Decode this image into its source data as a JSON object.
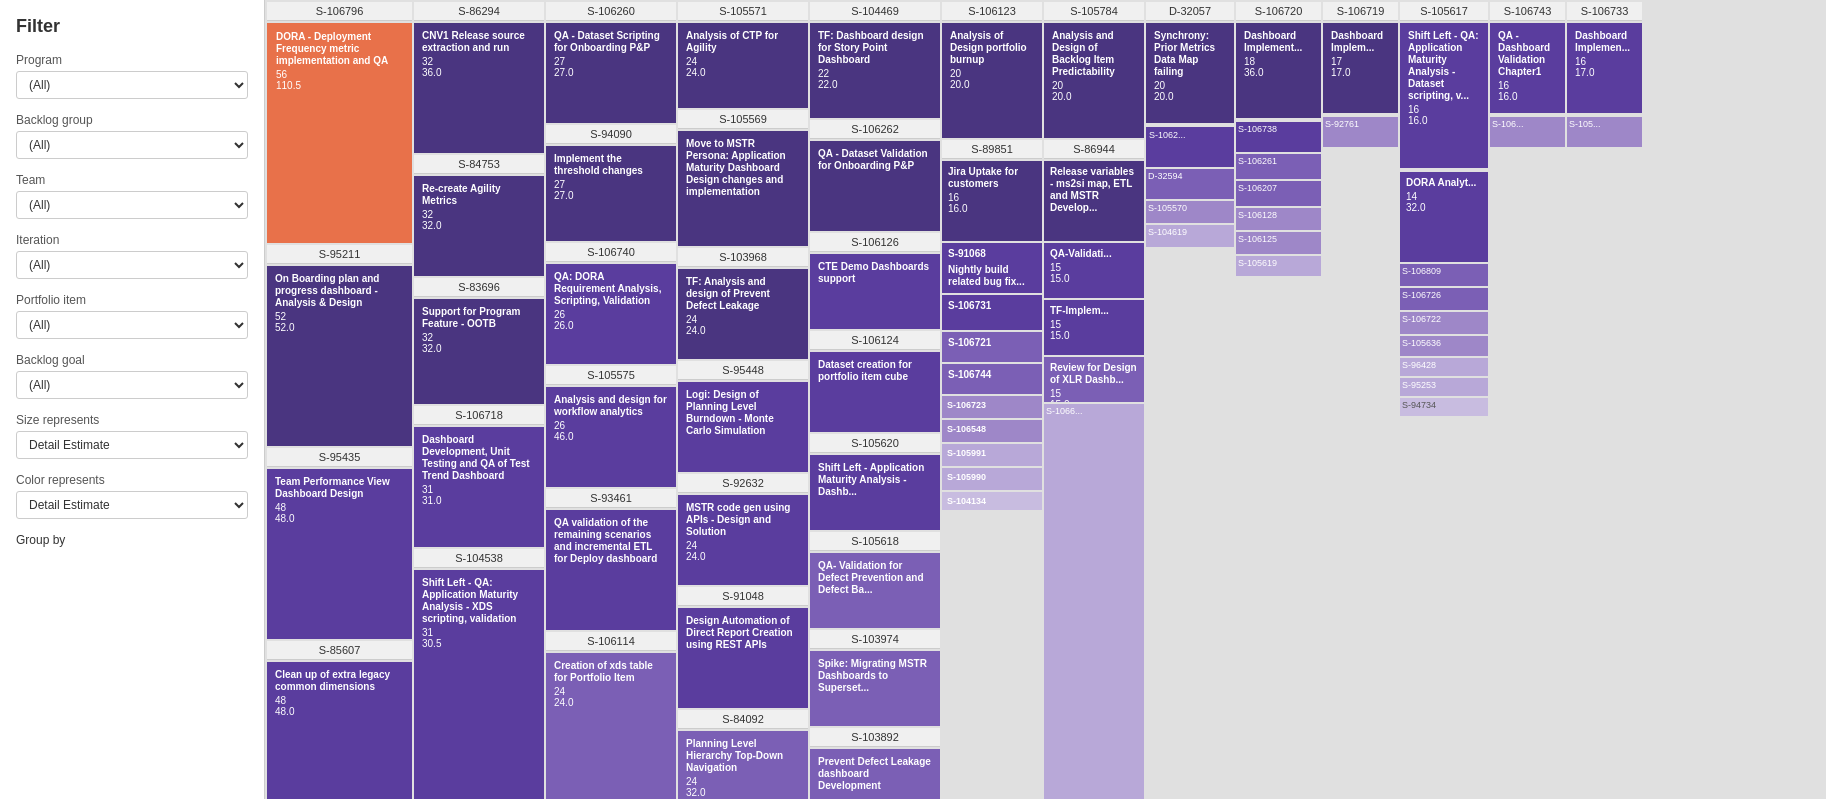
{
  "sidebar": {
    "title": "Filter",
    "filters": [
      {
        "id": "program",
        "label": "Program",
        "value": "(All)"
      },
      {
        "id": "backlog_group",
        "label": "Backlog group",
        "value": "(All)"
      },
      {
        "id": "team",
        "label": "Team",
        "value": "(All)"
      },
      {
        "id": "iteration",
        "label": "Iteration",
        "value": "(All)"
      },
      {
        "id": "portfolio_item",
        "label": "Portfolio item",
        "value": "(All)"
      },
      {
        "id": "backlog_goal",
        "label": "Backlog goal",
        "value": "(All)"
      }
    ],
    "size_represents_label": "Size represents",
    "size_represents_value": "Detail Estimate",
    "color_represents_label": "Color represents",
    "color_represents_value": "Detail Estimate",
    "group_by_label": "Group by"
  },
  "columns": [
    {
      "id": "S-106796",
      "header": "S-106796",
      "width": 145
    },
    {
      "id": "S-86294",
      "header": "S-86294",
      "width": 130
    },
    {
      "id": "S-106260",
      "header": "S-106260",
      "width": 130
    },
    {
      "id": "S-105571",
      "header": "S-105571",
      "width": 130
    },
    {
      "id": "S-104469",
      "header": "S-104469",
      "width": 130
    },
    {
      "id": "S-106123",
      "header": "S-106123",
      "width": 100
    },
    {
      "id": "S-105784",
      "header": "S-105784",
      "width": 100
    },
    {
      "id": "D-32057",
      "header": "D-32057",
      "width": 88
    },
    {
      "id": "S-106720",
      "header": "S-106720",
      "width": 85
    },
    {
      "id": "S-106719",
      "header": "S-106719",
      "width": 75
    },
    {
      "id": "S-105617",
      "header": "S-105617",
      "width": 88
    },
    {
      "id": "S-106743",
      "header": "S-106743",
      "width": 75
    },
    {
      "id": "S-106733",
      "header": "S-106733",
      "width": 75
    }
  ]
}
